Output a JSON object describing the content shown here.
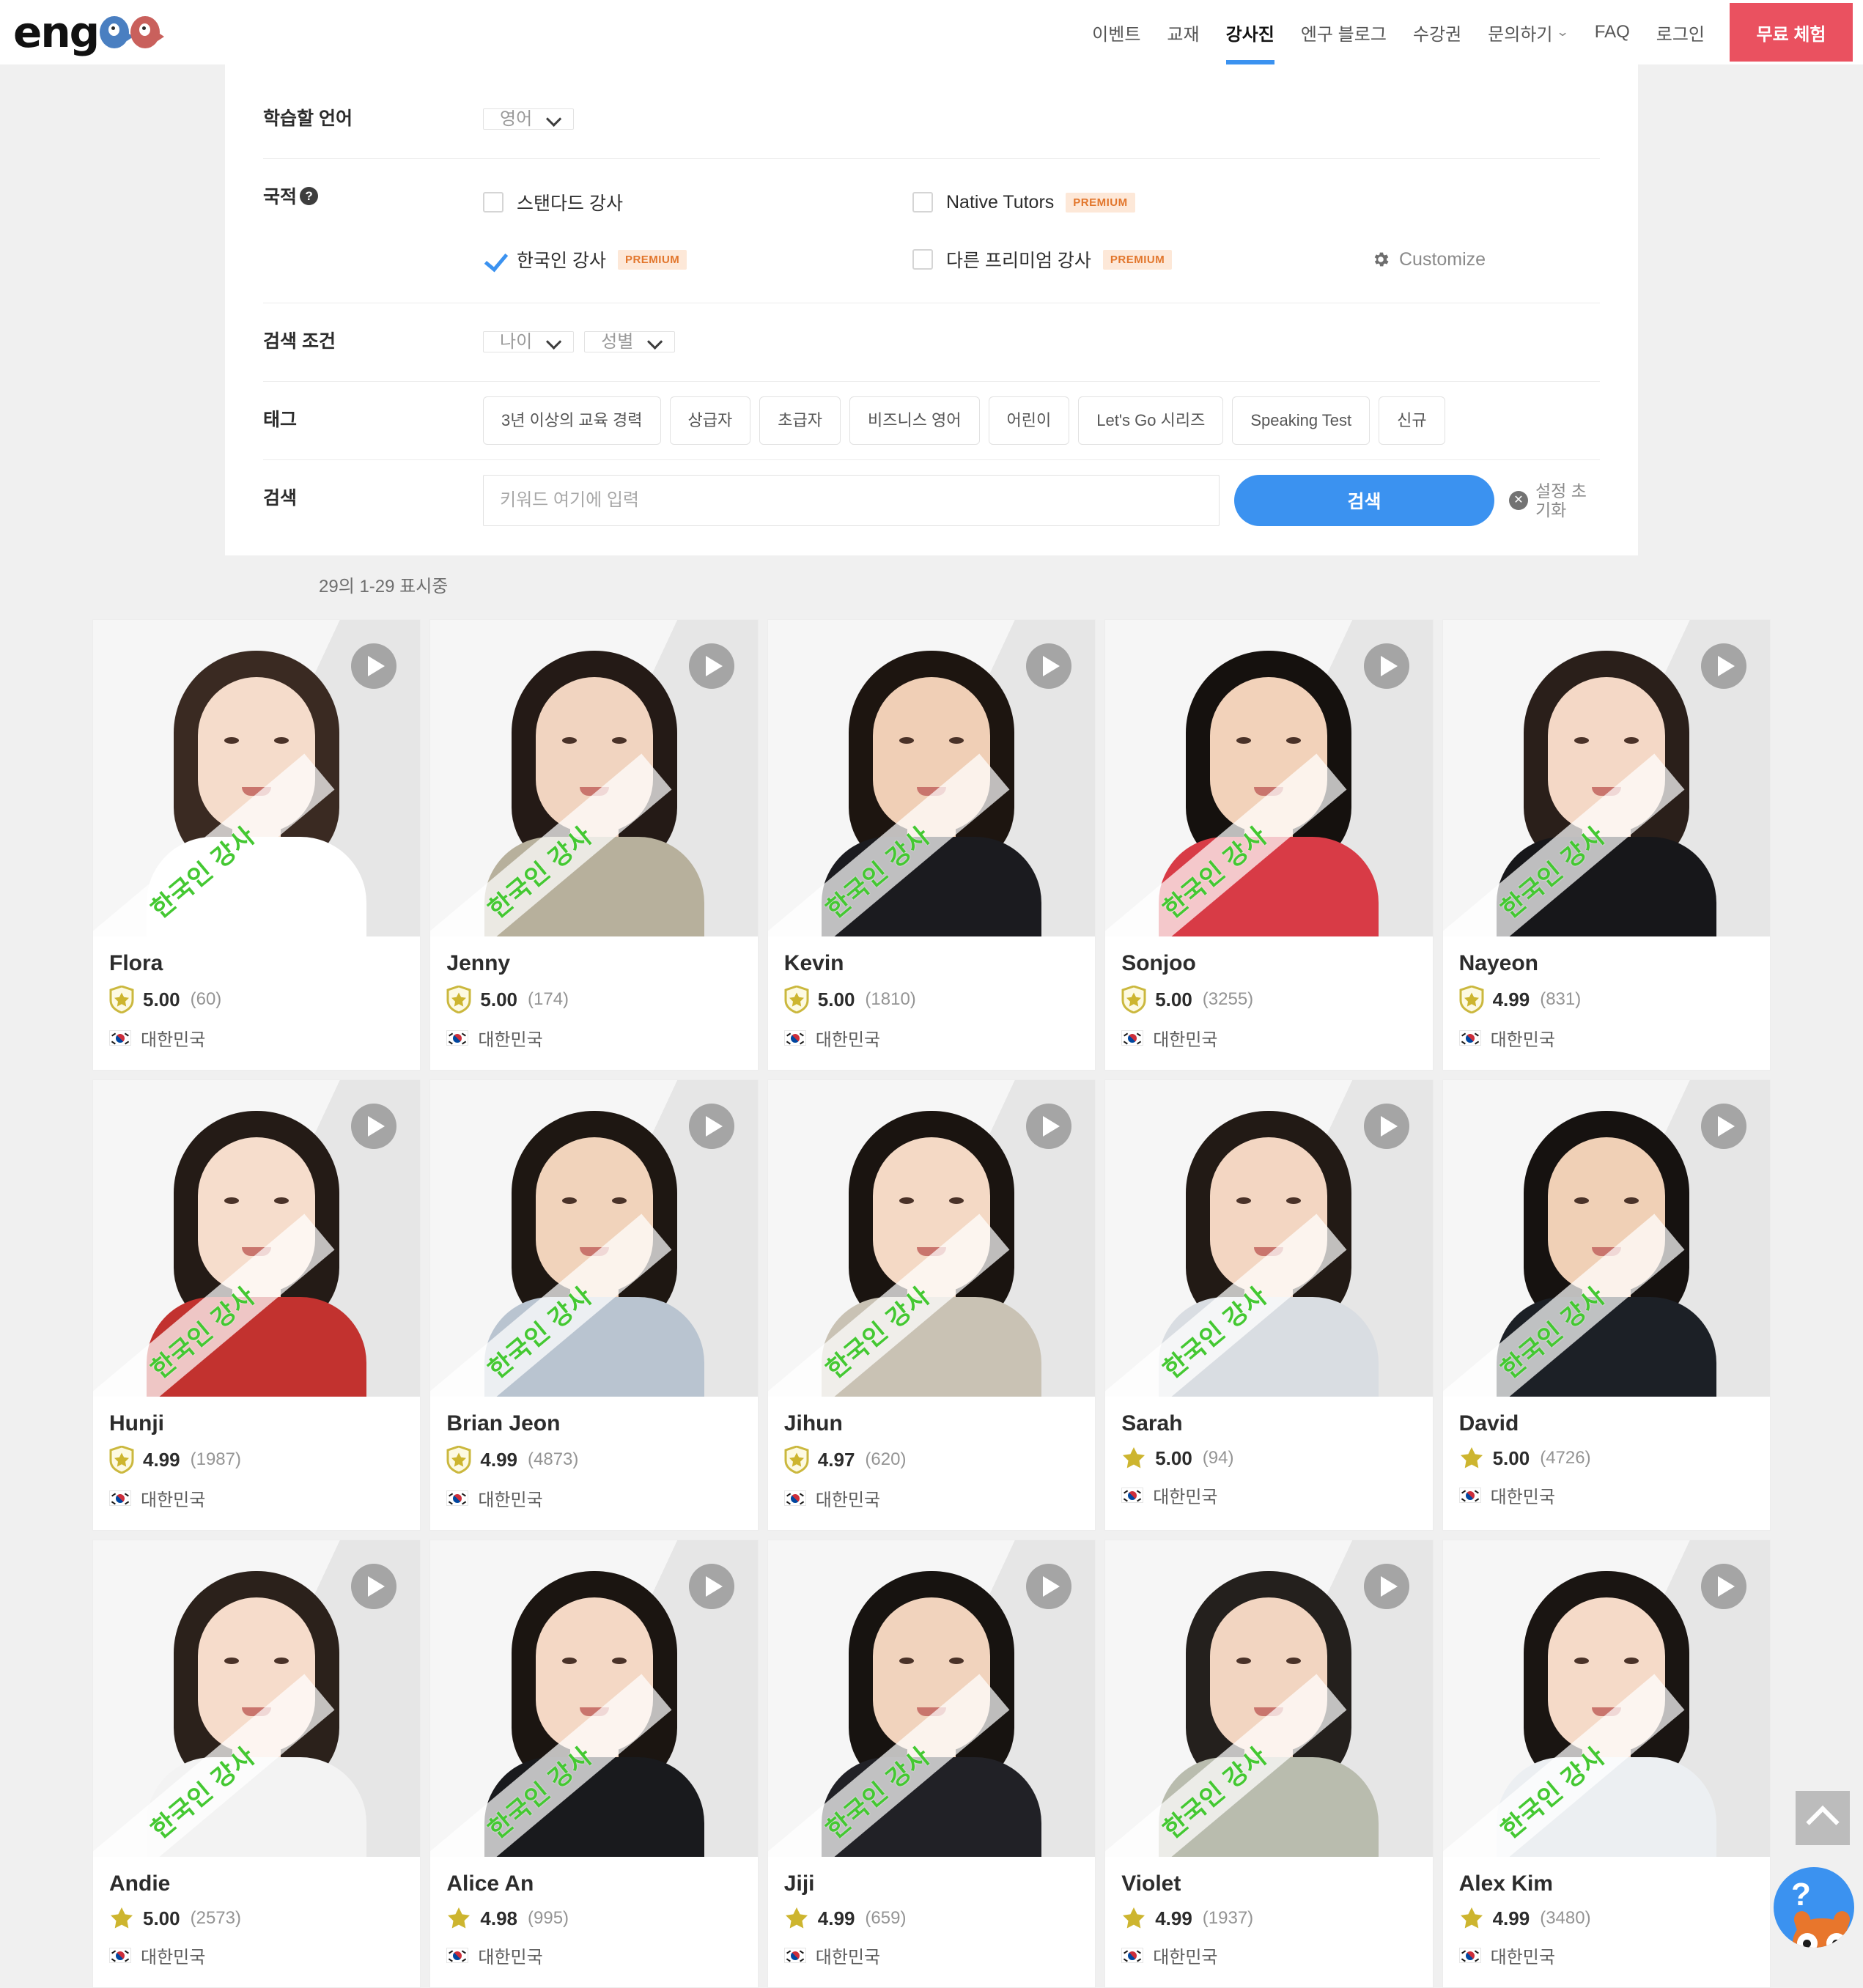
{
  "header": {
    "logo_text": "engoo",
    "nav": [
      {
        "label": "이벤트",
        "active": false,
        "caret": false
      },
      {
        "label": "교재",
        "active": false,
        "caret": false
      },
      {
        "label": "강사진",
        "active": true,
        "caret": false
      },
      {
        "label": "엔구 블로그",
        "active": false,
        "caret": false
      },
      {
        "label": "수강권",
        "active": false,
        "caret": false
      },
      {
        "label": "문의하기",
        "active": false,
        "caret": true
      },
      {
        "label": "FAQ",
        "active": false,
        "caret": false
      },
      {
        "label": "로그인",
        "active": false,
        "caret": false
      }
    ],
    "cta_label": "무료 체험",
    "cta_color": "#ea5160",
    "active_underline_color": "#3b92f0"
  },
  "filters": {
    "language": {
      "label": "학습할 언어",
      "value": "영어"
    },
    "nationality": {
      "label": "국적",
      "help_glyph": "?",
      "options": [
        {
          "label": "스탠다드 강사",
          "checked": false,
          "premium": false
        },
        {
          "label": "Native Tutors",
          "checked": false,
          "premium": true
        },
        {
          "label": "한국인 강사",
          "checked": true,
          "premium": true
        },
        {
          "label": "다른 프리미엄 강사",
          "checked": false,
          "premium": true
        }
      ],
      "premium_badge": "PREMIUM",
      "customize_label": "Customize"
    },
    "conditions": {
      "label": "검색 조건",
      "age": "나이",
      "gender": "성별"
    },
    "tags": {
      "label": "태그",
      "items": [
        "3년 이상의 교육 경력",
        "상급자",
        "초급자",
        "비즈니스 영어",
        "어린이",
        "Let's Go 시리즈",
        "Speaking Test",
        "신규"
      ]
    },
    "search": {
      "label": "검색",
      "placeholder": "키워드 여기에 입력",
      "value": "",
      "button_label": "검색",
      "reset_label": "설정 초기화",
      "button_color": "#3b92f0"
    }
  },
  "results": {
    "count_text": "29의 1-29 표시중",
    "ribbon_label": "한국인 강사",
    "ribbon_color": "#44c832",
    "country_label": "대한민국",
    "tutors": [
      {
        "name": "Flora",
        "rating": "5.00",
        "reviews": "(60)",
        "badge": "shield",
        "country": "대한민국",
        "hair": "#3a2a22",
        "body": "#ffffff",
        "skin": "#f5dccb"
      },
      {
        "name": "Jenny",
        "rating": "5.00",
        "reviews": "(174)",
        "badge": "shield",
        "country": "대한민국",
        "hair": "#241a16",
        "body": "#b7b09c",
        "skin": "#f1d4c0"
      },
      {
        "name": "Kevin",
        "rating": "5.00",
        "reviews": "(1810)",
        "badge": "shield",
        "country": "대한민국",
        "hair": "#1d1510",
        "body": "#1b1b1f",
        "skin": "#f0cfb6"
      },
      {
        "name": "Sonjoo",
        "rating": "5.00",
        "reviews": "(3255)",
        "badge": "shield",
        "country": "대한민국",
        "hair": "#15110e",
        "body": "#d83b46",
        "skin": "#f2d2ba"
      },
      {
        "name": "Nayeon",
        "rating": "4.99",
        "reviews": "(831)",
        "badge": "shield",
        "country": "대한민국",
        "hair": "#2a1f1a",
        "body": "#17171a",
        "skin": "#f4d8c6"
      },
      {
        "name": "Hunji",
        "rating": "4.99",
        "reviews": "(1987)",
        "badge": "shield",
        "country": "대한민국",
        "hair": "#241b16",
        "body": "#c2322f",
        "skin": "#f6ddcc"
      },
      {
        "name": "Brian Jeon",
        "rating": "4.99",
        "reviews": "(4873)",
        "badge": "shield",
        "country": "대한민국",
        "hair": "#1e1712",
        "body": "#b9c4d0",
        "skin": "#f1d3bb"
      },
      {
        "name": "Jihun",
        "rating": "4.97",
        "reviews": "(620)",
        "badge": "shield",
        "country": "대한민국",
        "hair": "#1a1410",
        "body": "#c9c2b4",
        "skin": "#f4d9c5"
      },
      {
        "name": "Sarah",
        "rating": "5.00",
        "reviews": "(94)",
        "badge": "star",
        "country": "대한민국",
        "hair": "#221a15",
        "body": "#d9dde2",
        "skin": "#f3d6c2"
      },
      {
        "name": "David",
        "rating": "5.00",
        "reviews": "(4726)",
        "badge": "star",
        "country": "대한민국",
        "hair": "#161210",
        "body": "#1c2026",
        "skin": "#f0d0b6"
      },
      {
        "name": "Andie",
        "rating": "5.00",
        "reviews": "(2573)",
        "badge": "star",
        "country": "대한민국",
        "hair": "#2b211b",
        "body": "#f3f3f3",
        "skin": "#f6dccb"
      },
      {
        "name": "Alice An",
        "rating": "4.98",
        "reviews": "(995)",
        "badge": "star",
        "country": "대한민국",
        "hair": "#1b1511",
        "body": "#191a1d",
        "skin": "#f4d8c5"
      },
      {
        "name": "Jiji",
        "rating": "4.99",
        "reviews": "(659)",
        "badge": "star",
        "country": "대한민국",
        "hair": "#171310",
        "body": "#212126",
        "skin": "#f1d3bd"
      },
      {
        "name": "Violet",
        "rating": "4.99",
        "reviews": "(1937)",
        "badge": "star",
        "country": "대한민국",
        "hair": "#24201d",
        "body": "#b9bcae",
        "skin": "#f2d5c1"
      },
      {
        "name": "Alex Kim",
        "rating": "4.99",
        "reviews": "(3480)",
        "badge": "star",
        "country": "대한민국",
        "hair": "#1a1512",
        "body": "#eceff2",
        "skin": "#f5dac8"
      }
    ]
  },
  "floating": {
    "scroll_top_icon": "chevron-up-icon",
    "help_icon": "help-owl-icon",
    "help_glyph": "?"
  }
}
